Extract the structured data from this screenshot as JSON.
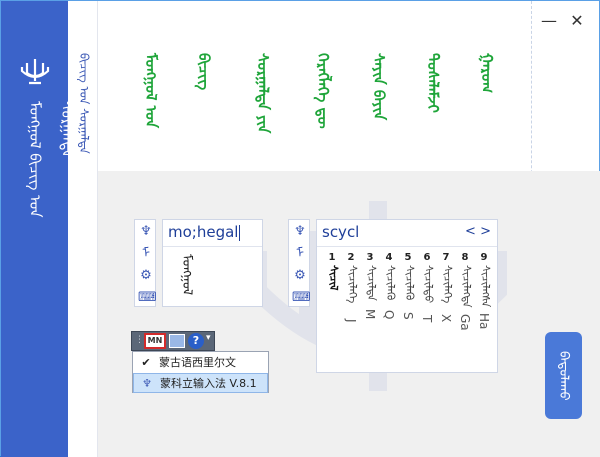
{
  "window": {
    "close_label": "✕",
    "minimize_label": "—"
  },
  "sidebar": {
    "title": "ᠮᠣᠩᠭᠣᠯ ᠪᠢᠴᠢᠭ ᠤᠨ ᠰᠤᠷᠭᠠᠯᠲᠠ",
    "logo_icon": "trident-icon"
  },
  "nav": {
    "link": "ᠪᠢᠴᠢᠭ ᠤᠨ ᠰᠤᠷᠭᠠᠯᠲᠠ"
  },
  "words": [
    "ᠮᠣᠩᠭᠣᠯ ᠤᠨ",
    "ᠪᠢᠴᠢᠭ",
    "ᠰᠤᠷᠭᠠᠯᠲᠠ ᠶᠢᠨ",
    "ᠬᠡᠷᠡᠭᠯᠡᠭᠡ ᠳᠦ",
    "ᠰᠠᠶᠢᠨ ᠪᠠᠶᠢᠨ",
    "ᠲᠤᠰᠠᠯᠠᠮᠵᠢ",
    "ᠭᠠᠷᠤᠭ"
  ],
  "input_left": {
    "text": "mo;hegal",
    "candidate": "ᠮᠣᠩᠭᠣᠯ"
  },
  "input_right": {
    "text": "scycl",
    "nav_prev": "<",
    "nav_next": ">",
    "candidates": [
      {
        "num": "1",
        "word": "ᠰᠢᠴᠢᠯ",
        "latin": ""
      },
      {
        "num": "2",
        "word": "ᠰᠢᠴᠢᠯᠡᠭᠡ",
        "latin": "J"
      },
      {
        "num": "3",
        "word": "ᠰᠢᠴᠢᠯᠲᠡ",
        "latin": "M"
      },
      {
        "num": "4",
        "word": "ᠰᠢᠴᠢᠯᠡᠬᠦ",
        "latin": "Q"
      },
      {
        "num": "5",
        "word": "ᠰᠢᠴᠢᠯᠡᠭᠦ",
        "latin": "S"
      },
      {
        "num": "6",
        "word": "ᠰᠢᠴᠢᠯᠳᠦ",
        "latin": "T"
      },
      {
        "num": "7",
        "word": "ᠰᠢᠴᠢᠯᠡᠬᠡ",
        "latin": "X"
      },
      {
        "num": "8",
        "word": "ᠰᠢᠴᠢᠯᠡᠭᠳᠡ",
        "latin": "Ga"
      },
      {
        "num": "9",
        "word": "ᠰᠢᠴᠢᠯᠡᠭᠰᠡ",
        "latin": "Ha"
      }
    ]
  },
  "toolbar": {
    "mn_label": "MN",
    "help_label": "?",
    "arrow_label": "▾"
  },
  "menu": {
    "items": [
      {
        "mark": "✔",
        "label": "蒙古语西里尔文"
      },
      {
        "mark": "♆",
        "label": "蒙科立输入法 V.8.1"
      }
    ]
  },
  "confirm_button": {
    "label": "ᠪᠠᠲᠤᠯᠠᠬᠤ"
  }
}
